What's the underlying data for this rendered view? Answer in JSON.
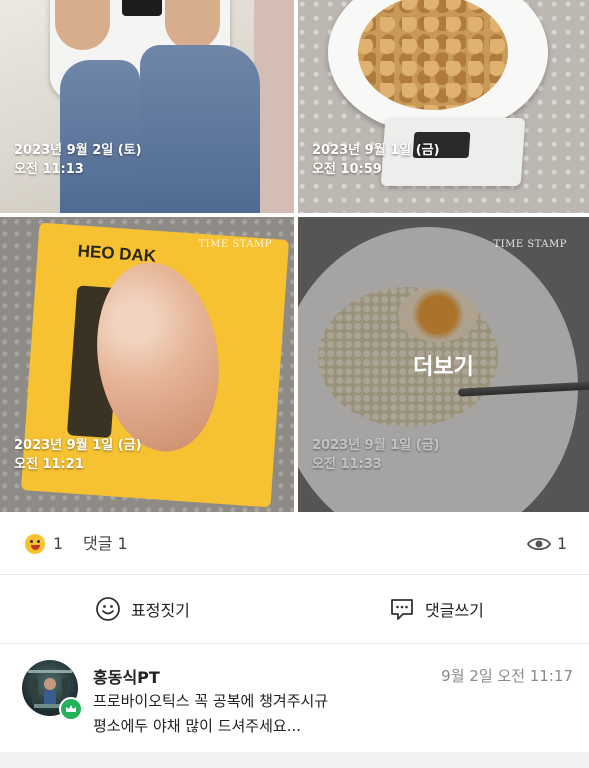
{
  "photos": [
    {
      "date": "2023년 9월 2일 (토)",
      "time": "오전 11:13",
      "has_logo": false
    },
    {
      "date": "2023년 9월 1일 (금)",
      "time": "오전 10:59",
      "has_logo": false
    },
    {
      "date": "2023년 9월 1일 (금)",
      "time": "오전 11:21",
      "has_logo": true
    },
    {
      "date": "2023년 9월 1일 (금)",
      "time": "오전 11:33",
      "has_logo": true
    }
  ],
  "timestamp_logo": "TIME STAMP",
  "package_brand": "HEO DAK",
  "more_label": "더보기",
  "reactions": {
    "emoji_count": "1",
    "comment_label": "댓글 1",
    "view_count": "1"
  },
  "actions": {
    "emote_label": "표정짓기",
    "comment_label": "댓글쓰기"
  },
  "comment": {
    "author": "홍동식PT",
    "timestamp": "9월 2일 오전 11:17",
    "lines": [
      "프로바이오틱스 꼭 공복에 챙겨주시규",
      "평소에두 야채 많이 드셔주세요..."
    ]
  },
  "colors": {
    "emoji_yellow": "#fbc02d",
    "badge_green": "#22b35a",
    "muted_text": "#8a8a8a"
  }
}
